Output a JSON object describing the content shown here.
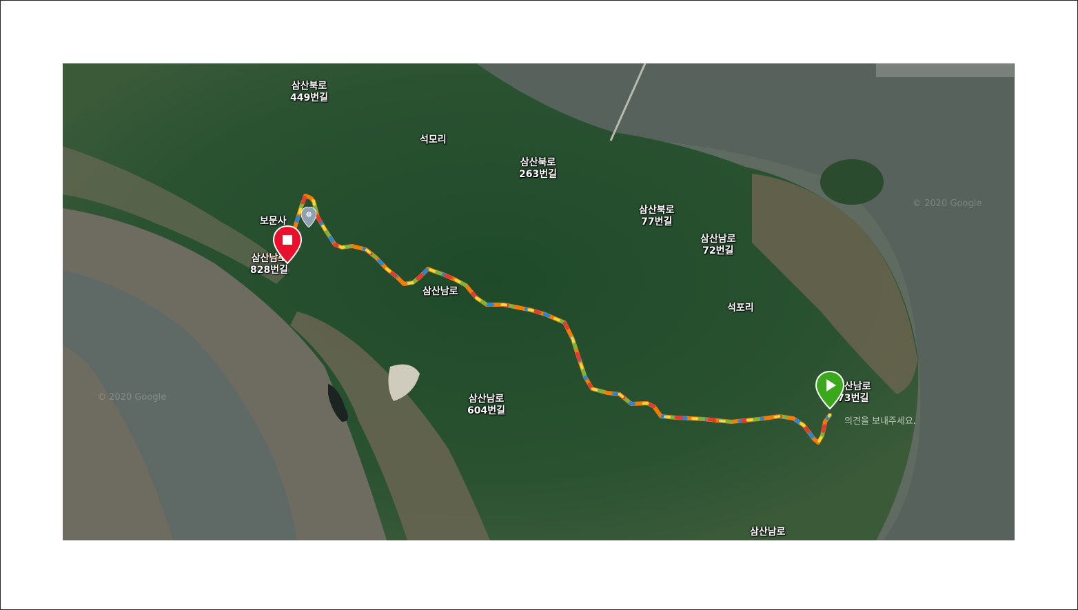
{
  "map": {
    "type": "satellite",
    "labels": [
      {
        "id": "samsanbukro449",
        "line1": "삼산북로",
        "line2": "449번길"
      },
      {
        "id": "seokmori",
        "line1": "석모리",
        "line2": ""
      },
      {
        "id": "samsanbukro263",
        "line1": "삼산북로",
        "line2": "263번길"
      },
      {
        "id": "samsanbukro77",
        "line1": "삼산북로",
        "line2": "77번길"
      },
      {
        "id": "samsannamro72",
        "line1": "삼산남로",
        "line2": "72번길"
      },
      {
        "id": "seokpori",
        "line1": "석포리",
        "line2": ""
      },
      {
        "id": "bomunsa",
        "line1": "보문사",
        "line2": ""
      },
      {
        "id": "samsannamro828",
        "line1": "삼산남로",
        "line2": "828번길"
      },
      {
        "id": "samsannamro",
        "line1": "삼산남로",
        "line2": ""
      },
      {
        "id": "samsannamro604",
        "line1": "삼산남로",
        "line2": "604번길"
      },
      {
        "id": "samsannamro73",
        "line1": "삼산남로",
        "line2": "73번길"
      },
      {
        "id": "samsannamro_bottom",
        "line1": "삼산남로",
        "line2": ""
      }
    ],
    "watermarks": [
      "© 2020 Google",
      "© 2020 Google"
    ],
    "feedback_text": "의견을 보내주세요.",
    "start_marker": {
      "icon": "play-icon",
      "color": "#3aa81a"
    },
    "end_marker": {
      "icon": "stop-icon",
      "color": "#e8102a"
    },
    "poi_marker": {
      "icon": "temple-icon"
    },
    "track_colors": [
      "#1e88e5",
      "#7cb342",
      "#fdd835",
      "#fb8c00",
      "#e53935"
    ],
    "colors": {
      "sea": "#6f7a6e",
      "mudflat": "#6d6a60",
      "forest": "#264a2c"
    }
  }
}
